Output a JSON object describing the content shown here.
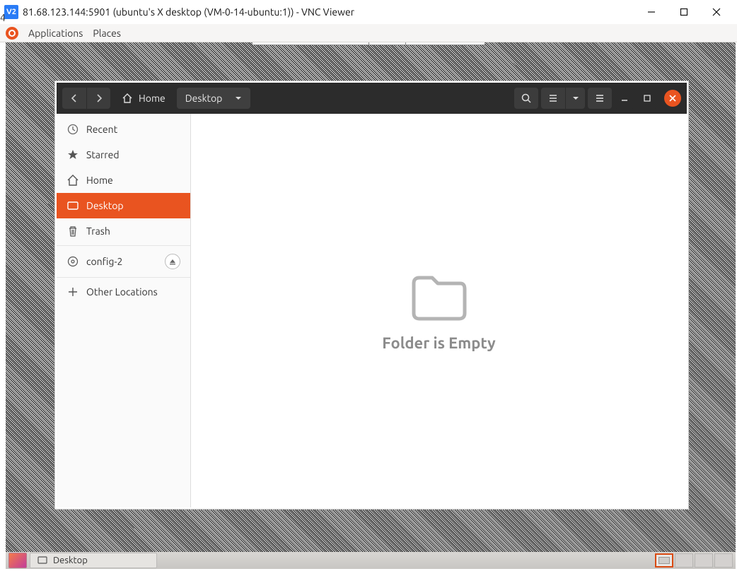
{
  "vnc": {
    "icon_text": "V2",
    "title": "81.68.123.144:5901 (ubuntu's X desktop (VM-0-14-ubuntu:1)) - VNC Viewer"
  },
  "host_pagenum": "4",
  "ubuntu_menubar": {
    "applications": "Applications",
    "places": "Places"
  },
  "nautilus": {
    "breadcrumb": {
      "home_label": "Home",
      "current_label": "Desktop"
    },
    "sidebar": {
      "recent": "Recent",
      "starred": "Starred",
      "home": "Home",
      "desktop": "Desktop",
      "trash": "Trash",
      "config2": "config-2",
      "other": "Other Locations"
    },
    "empty_text": "Folder is Empty"
  },
  "taskbar": {
    "active_window": "Desktop"
  }
}
